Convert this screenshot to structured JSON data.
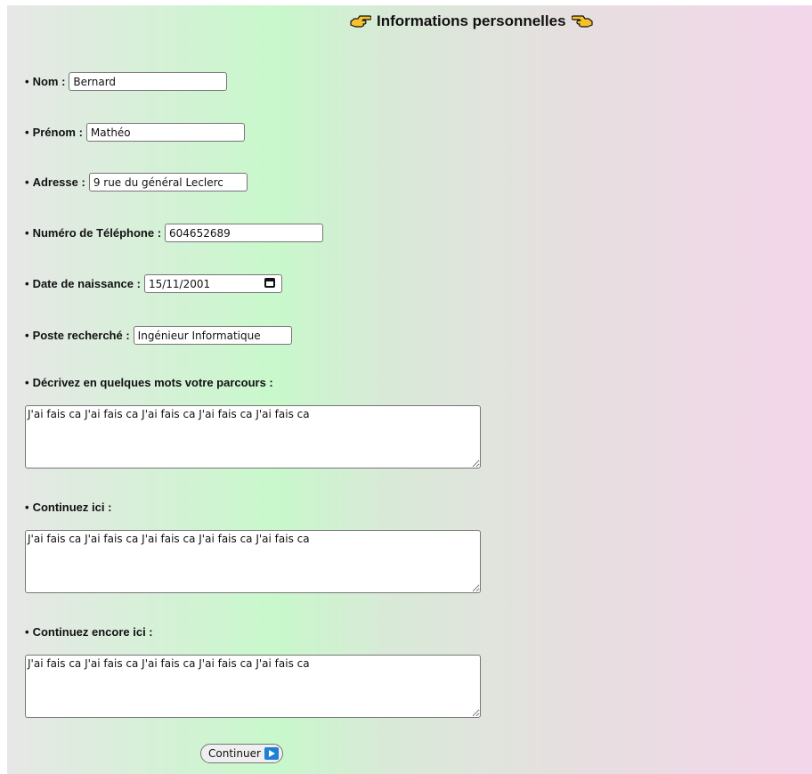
{
  "title": "Informations personnelles",
  "fields": {
    "nom": {
      "label": "Nom :",
      "value": "Bernard"
    },
    "prenom": {
      "label": "Prénom :",
      "value": "Mathéo"
    },
    "adresse": {
      "label": "Adresse :",
      "value": "9 rue du général Leclerc"
    },
    "telephone": {
      "label": "Numéro de Téléphone :",
      "value": "604652689"
    },
    "naissance": {
      "label": "Date de naissance :",
      "value": "15/11/2001"
    },
    "poste": {
      "label": "Poste recherché :",
      "value": "Ingénieur Informatique"
    }
  },
  "textareas": {
    "parcours": {
      "label": "Décrivez en quelques mots votre parcours :",
      "value": "J'ai fais ca J'ai fais ca J'ai fais ca J'ai fais ca J'ai fais ca"
    },
    "continuez": {
      "label": "Continuez ici :",
      "value": "J'ai fais ca J'ai fais ca J'ai fais ca J'ai fais ca J'ai fais ca"
    },
    "encore": {
      "label": "Continuez encore ici :",
      "value": "J'ai fais ca J'ai fais ca J'ai fais ca J'ai fais ca J'ai fais ca"
    }
  },
  "bullet": "•",
  "submit_label": "Continuer",
  "icons": {
    "left": "pointing-right-hand-icon",
    "right": "pointing-left-hand-icon",
    "calendar": "calendar-icon",
    "play": "play-icon"
  }
}
